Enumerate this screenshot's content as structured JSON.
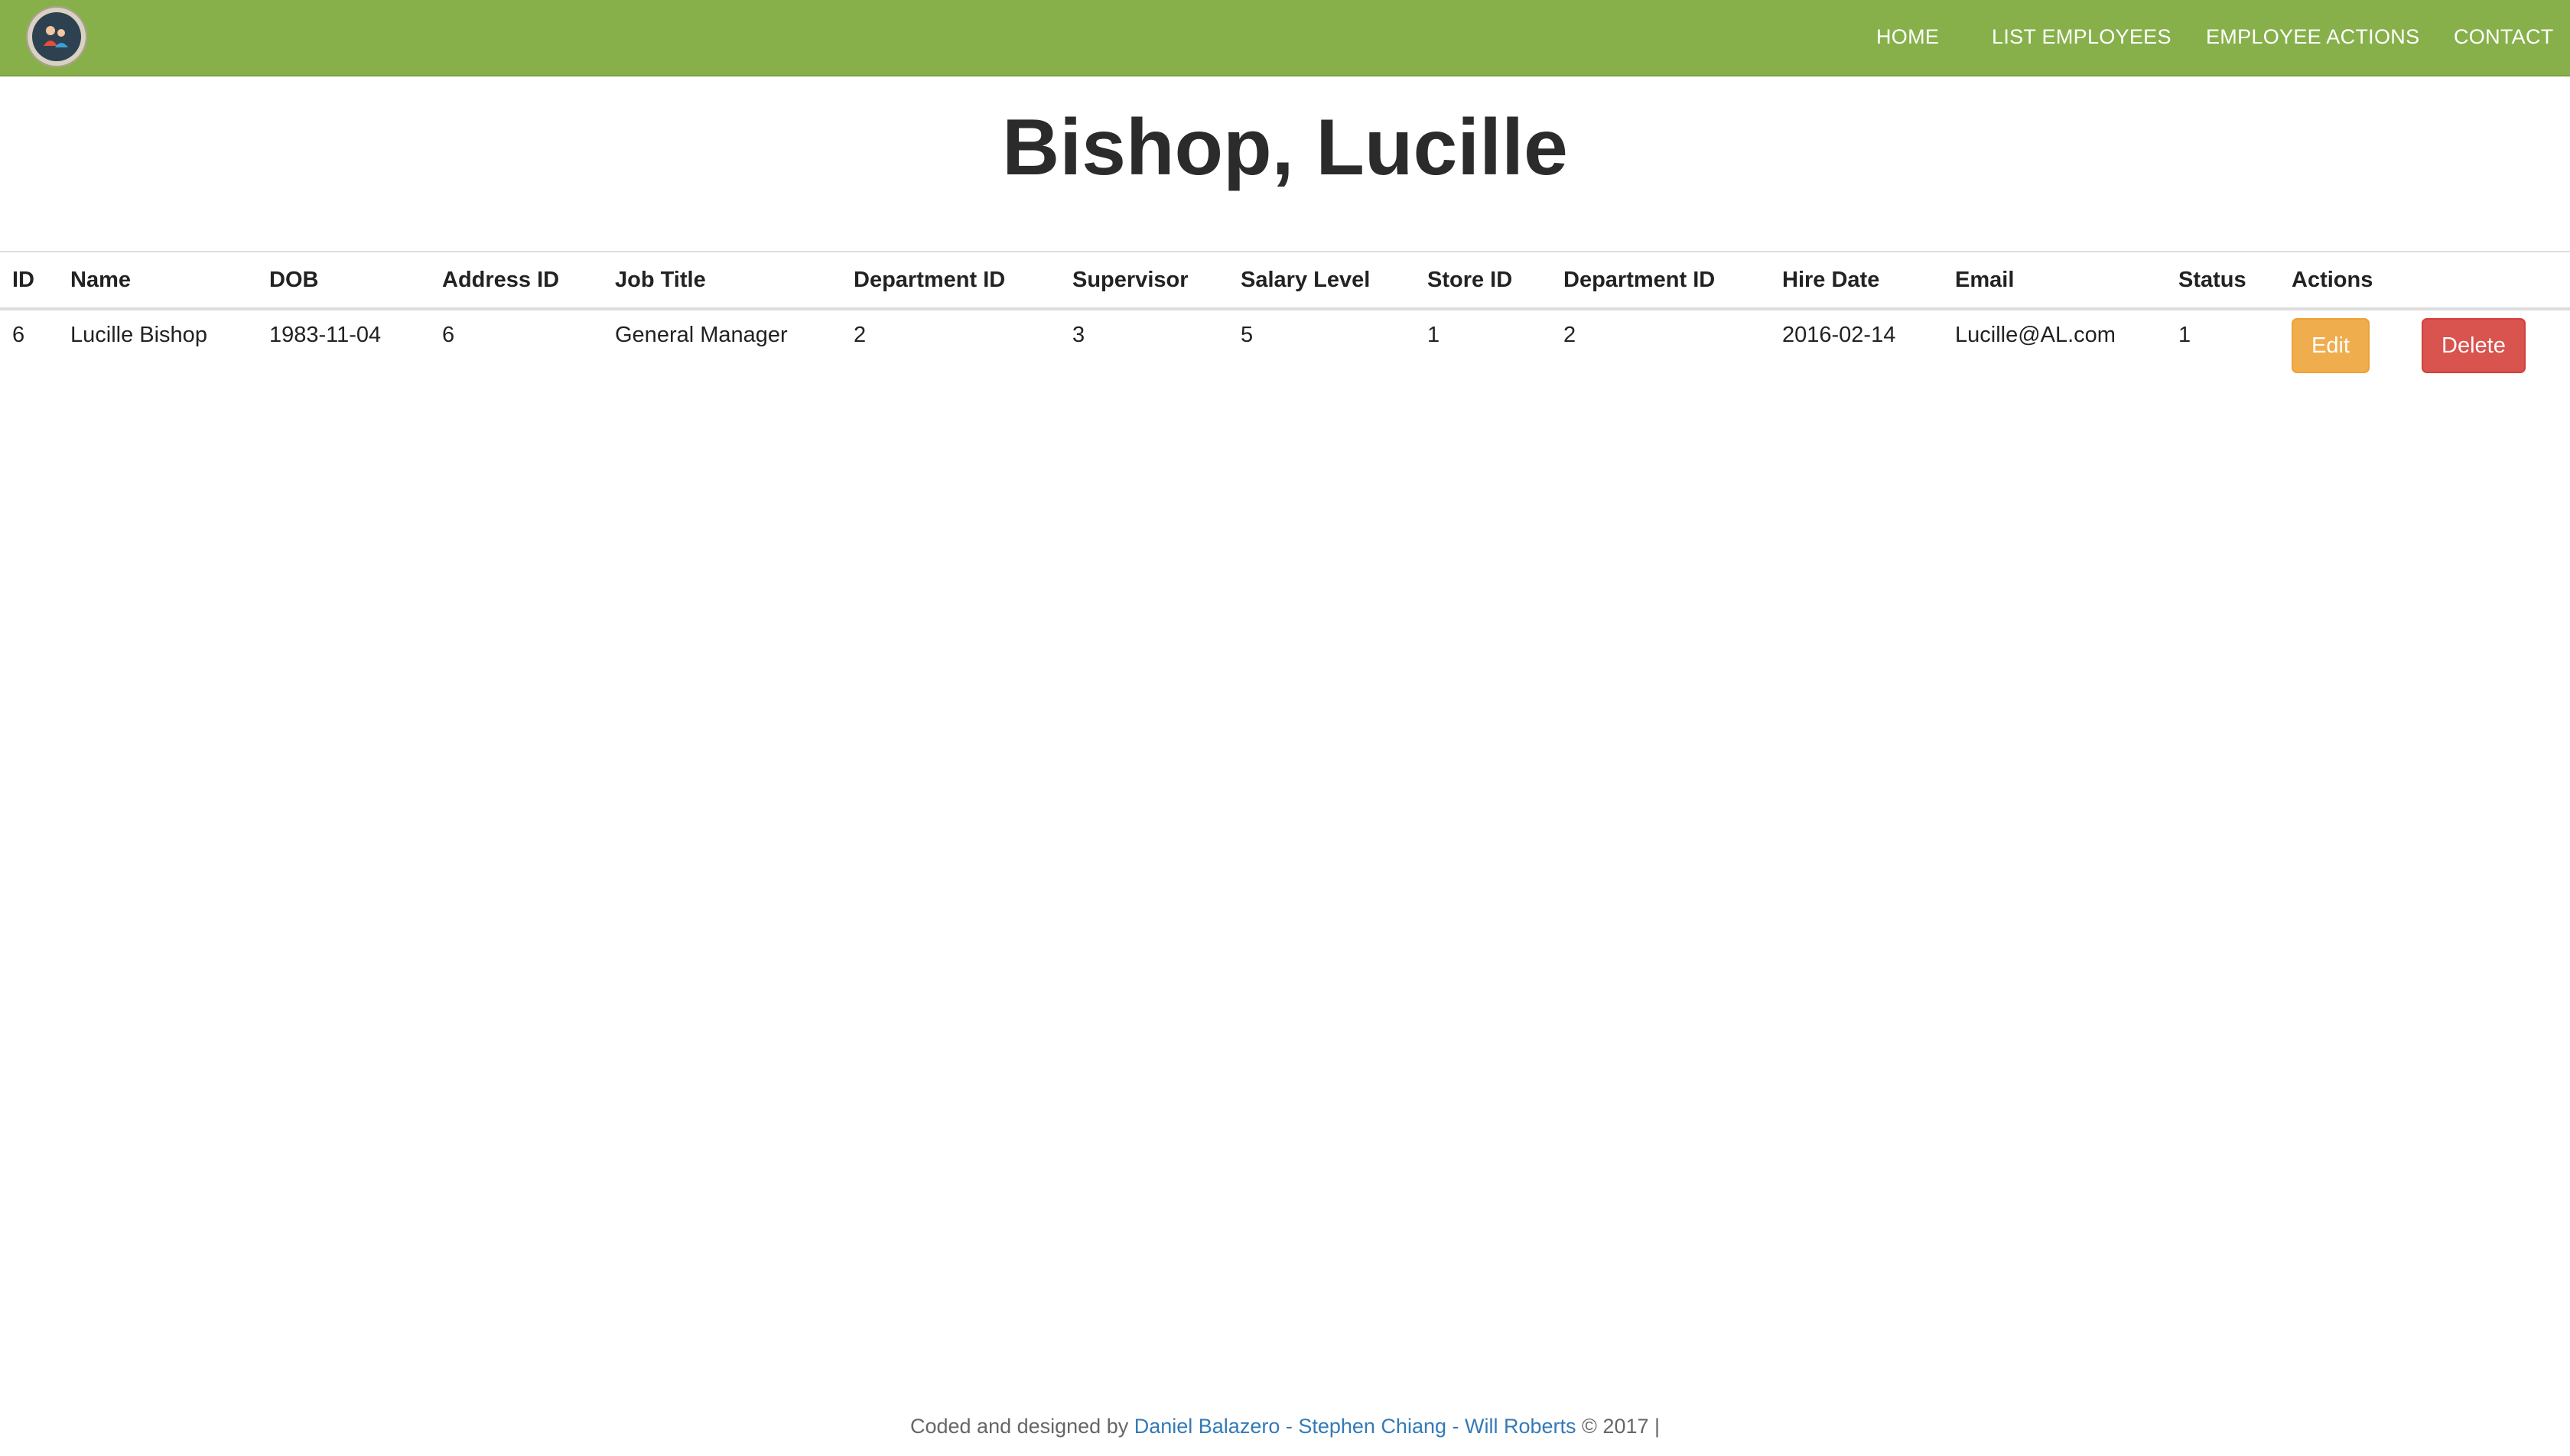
{
  "nav": {
    "links": [
      "HOME",
      "LIST EMPLOYEES",
      "EMPLOYEE ACTIONS",
      "CONTACT"
    ]
  },
  "page": {
    "title": "Bishop, Lucille"
  },
  "table": {
    "headers": [
      "ID",
      "Name",
      "DOB",
      "Address ID",
      "Job Title",
      "Department ID",
      "Supervisor",
      "Salary Level",
      "Store ID",
      "Department ID",
      "Hire Date",
      "Email",
      "Status",
      "Actions"
    ],
    "rows": [
      {
        "cells": [
          "6",
          "Lucille Bishop",
          "1983-11-04",
          "6",
          "General Manager",
          "2",
          "3",
          "5",
          "1",
          "2",
          "2016-02-14",
          "Lucille@AL.com",
          "1"
        ],
        "edit_label": "Edit",
        "delete_label": "Delete"
      }
    ]
  },
  "footer": {
    "prefix": "Coded and designed by",
    "authors": "Daniel Balazero - Stephen Chiang - Will Roberts",
    "suffix": "© 2017 |"
  },
  "colors": {
    "navbar": "#87b04b",
    "edit": "#f0ad4e",
    "delete": "#d9534f",
    "link": "#337ab7"
  },
  "icons": {
    "logo": "team-logo-icon"
  }
}
